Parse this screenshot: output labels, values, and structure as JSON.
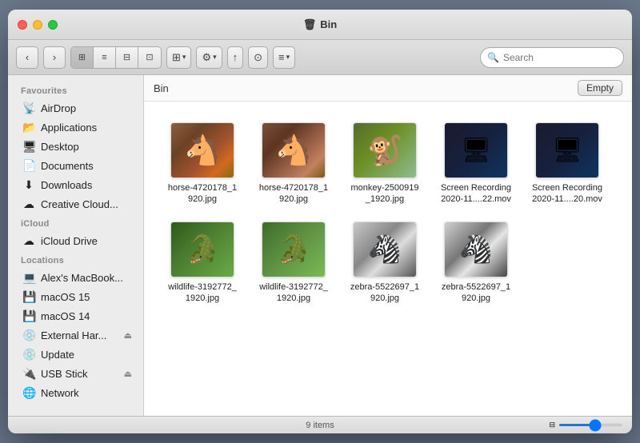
{
  "window": {
    "title": "🗑 Bin"
  },
  "toolbar": {
    "back_label": "‹",
    "forward_label": "›",
    "search_placeholder": "Search",
    "empty_label": "Empty"
  },
  "sidebar": {
    "favourites_header": "Favourites",
    "icloud_header": "iCloud",
    "locations_header": "Locations",
    "items": {
      "airdrop": "AirDrop",
      "applications": "Applications",
      "desktop": "Desktop",
      "documents": "Documents",
      "downloads": "Downloads",
      "creative_cloud": "Creative Cloud...",
      "icloud_drive": "iCloud Drive",
      "alexs_macbook": "Alex's MacBook...",
      "macos15": "macOS 15",
      "macos14": "macOS 14",
      "external_har": "External Har...",
      "update": "Update",
      "usb_stick": "USB Stick",
      "network": "Network"
    }
  },
  "content": {
    "breadcrumb": "Bin",
    "item_count": "9 items"
  },
  "files": [
    {
      "name": "horse-4720178_1920.jpg",
      "type": "horse",
      "display_name": "horse-4720178_1\n920.jpg"
    },
    {
      "name": "horse-4720178_1920.jpg",
      "type": "horse2",
      "display_name": "horse-4720178_1\n920.jpg"
    },
    {
      "name": "monkey-2500919_1920.jpg",
      "type": "monkey",
      "display_name": "monkey-2500919\n_1920.jpg"
    },
    {
      "name": "Screen Recording 2020-11....22.mov",
      "type": "screen",
      "display_name": "Screen Recording\n2020-11....22.mov"
    },
    {
      "name": "Screen Recording 2020-11....20.mov",
      "type": "screen",
      "display_name": "Screen Recording\n2020-11....20.mov"
    },
    {
      "name": "wildlife-3192772_1920.jpg",
      "type": "croc",
      "display_name": "wildlife-3192772_\n1920.jpg"
    },
    {
      "name": "wildlife-3192772_1920.jpg",
      "type": "croc2",
      "display_name": "wildlife-3192772_\n1920.jpg"
    },
    {
      "name": "zebra-5522697_1920.jpg",
      "type": "zebra",
      "display_name": "zebra-5522697_1\n920.jpg"
    },
    {
      "name": "zebra-5522697_1920.jpg",
      "type": "zebra2",
      "display_name": "zebra-5522697_1\n920.jpg"
    }
  ]
}
